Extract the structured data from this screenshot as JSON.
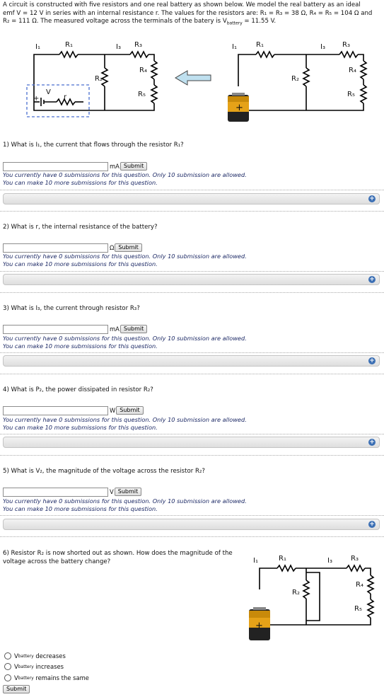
{
  "intro": {
    "line1": "A circuit is constructed with five resistors and one real battery as shown below. We model the real battery as an ideal",
    "line2": "emf V = 12 V in series with an internal resistance r. The values for the resistors are: R₁ = R₃ = 38 Ω, R₄ = R₅ = 104 Ω and",
    "line3a": "R₂ = 111 Ω. The measured voltage across the terminals of the batery is V",
    "line3sub": "battery",
    "line3b": " = 11.55 V."
  },
  "diagram_labels": {
    "I1": "I₁",
    "I3": "I₃",
    "R1": "R₁",
    "R2": "R₂",
    "R3": "R₃",
    "R4": "R₄",
    "R5": "R₅",
    "V": "V",
    "r": "r",
    "plus": "+"
  },
  "questions": [
    {
      "label": "1) What is I₁, the current that flows through the resistor R₁?",
      "unit": "mA",
      "submit": "Submit"
    },
    {
      "label": "2) What is r, the internal resistance of the battery?",
      "unit": "Ω",
      "submit": "Submit"
    },
    {
      "label": "3) What is I₃, the current through resistor R₃?",
      "unit": "mA",
      "submit": "Submit"
    },
    {
      "label": "4) What is P₂, the power dissipated in resistor R₂?",
      "unit": "W",
      "submit": "Submit"
    },
    {
      "label": "5) What is V₂, the magnitude of the voltage across the resistor R₂?",
      "unit": "V",
      "submit": "Submit"
    }
  ],
  "submission_msg1": "You currently have 0 submissions for this question. Only 10 submission are allowed.",
  "submission_msg2": "You can make 10 more submissions for this question.",
  "q6": {
    "line1": "6) Resistor R₂ is now shorted out as shown. How does the magnitude of the",
    "line2": "voltage across the battery change?",
    "options": [
      {
        "v": "V",
        "sub": "battery",
        "text": "decreases"
      },
      {
        "v": "V",
        "sub": "battery",
        "text": "increases"
      },
      {
        "v": "V",
        "sub": "battery",
        "text": "remains the same"
      }
    ],
    "submit": "Submit"
  }
}
